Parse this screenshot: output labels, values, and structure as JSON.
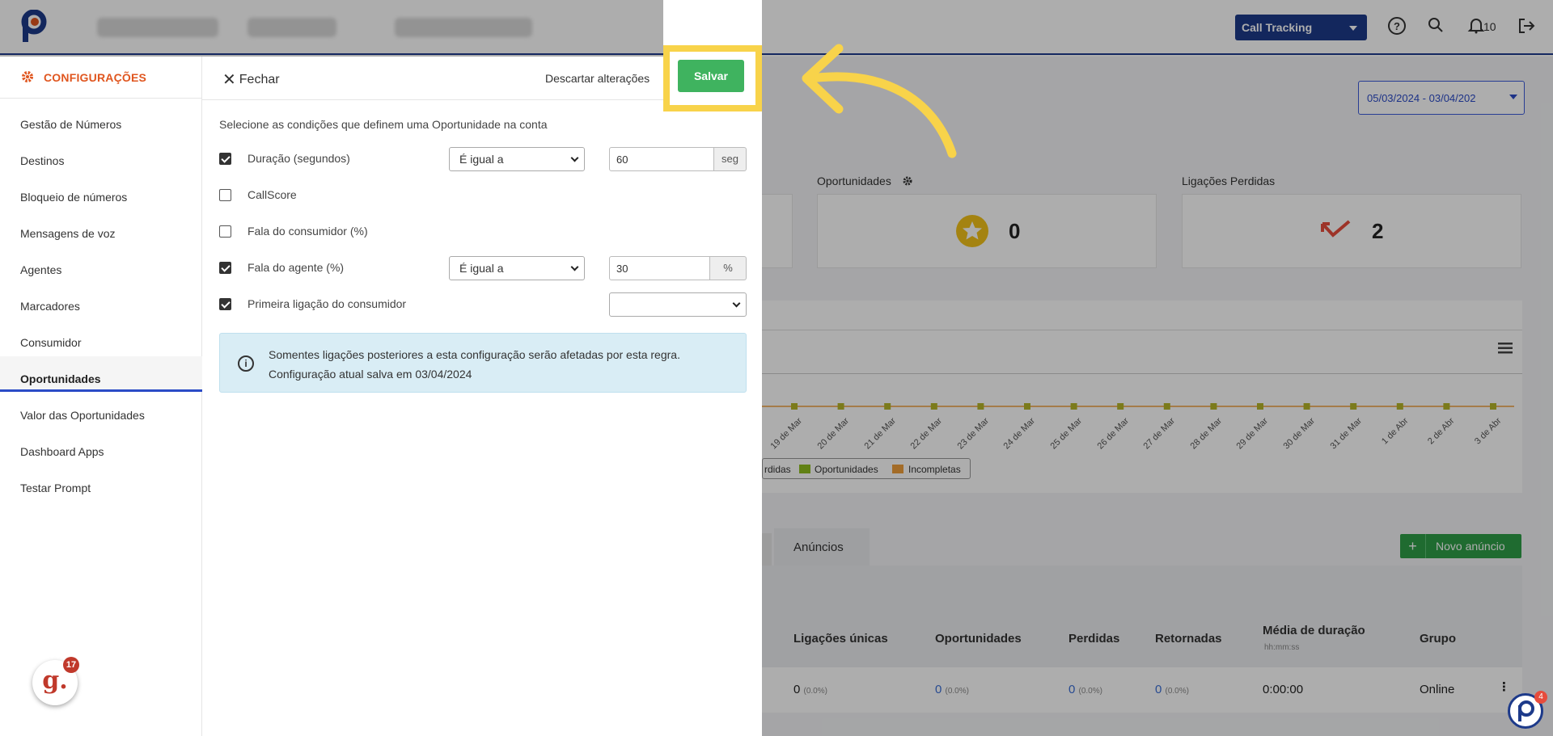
{
  "topbar": {
    "product_select": "Call Tracking",
    "notifications_count": "10",
    "icons": [
      "help-icon",
      "search-icon",
      "bell-icon",
      "logout-icon"
    ]
  },
  "dashboard": {
    "date_range": "05/03/2024 - 03/04/202",
    "cards": {
      "opportunities_title": "Oportunidades",
      "opportunities_value": "0",
      "lost_calls_title": "Ligações Perdidas",
      "lost_calls_value": "2"
    },
    "chart_ticks": [
      "19 de Mar",
      "20 de Mar",
      "21 de Mar",
      "22 de Mar",
      "23 de Mar",
      "24 de Mar",
      "25 de Mar",
      "26 de Mar",
      "27 de Mar",
      "28 de Mar",
      "29 de Mar",
      "30 de Mar",
      "31 de Mar",
      "1 de Abr",
      "2 de Abr",
      "3 de Abr"
    ],
    "legend": {
      "lost": "rdidas",
      "opportunities": "Oportunidades",
      "incomplete": "Incompletas"
    },
    "tab_ads": "Anúncios",
    "new_ad_button": "Novo anúncio",
    "table_headers": {
      "unique_calls": "Ligações únicas",
      "opportunities": "Oportunidades",
      "lost": "Perdidas",
      "returned": "Retornadas",
      "avg_duration": "Média de duração",
      "avg_duration_sub": "hh:mm:ss",
      "group": "Grupo"
    },
    "row": {
      "unique_calls": "0",
      "unique_calls_pct": "(0.0%)",
      "opportunities": "0",
      "opportunities_pct": "(0.0%)",
      "lost": "0",
      "lost_pct": "(0.0%)",
      "returned": "0",
      "returned_pct": "(0.0%)",
      "avg_duration": "0:00:00",
      "group": "Online"
    }
  },
  "sidebar": {
    "title": "CONFIGURAÇÕES",
    "items": [
      {
        "label": "Gestão de Números"
      },
      {
        "label": "Destinos"
      },
      {
        "label": "Bloqueio de números"
      },
      {
        "label": "Mensagens de voz"
      },
      {
        "label": "Agentes"
      },
      {
        "label": "Marcadores"
      },
      {
        "label": "Consumidor"
      },
      {
        "label": "Oportunidades"
      },
      {
        "label": "Valor das Oportunidades"
      },
      {
        "label": "Dashboard Apps"
      },
      {
        "label": "Testar Prompt"
      }
    ],
    "active": "Oportunidades"
  },
  "panel": {
    "close_label": "Fechar",
    "discard_label": "Descartar alterações",
    "save_label": "Salvar",
    "intro": "Selecione as condições que definem uma Oportunidade na conta",
    "conditions": [
      {
        "label": "Duração (segundos)",
        "checked": true,
        "operator": "É igual a",
        "value": "60",
        "unit": "seg"
      },
      {
        "label": "CallScore",
        "checked": false
      },
      {
        "label": "Fala do consumidor (%)",
        "checked": false
      },
      {
        "label": "Fala do agente (%)",
        "checked": true,
        "operator": "É igual a",
        "value": "30",
        "unit": "%"
      },
      {
        "label": "Primeira ligação do consumidor",
        "checked": true,
        "operator": ""
      }
    ],
    "info_line1": "Somentes ligações posteriores a esta configuração serão afetadas por esta regra.",
    "info_line2": "Configuração atual salva em 03/04/2024"
  },
  "widgets": {
    "g_count": "17",
    "p_count": "4"
  }
}
